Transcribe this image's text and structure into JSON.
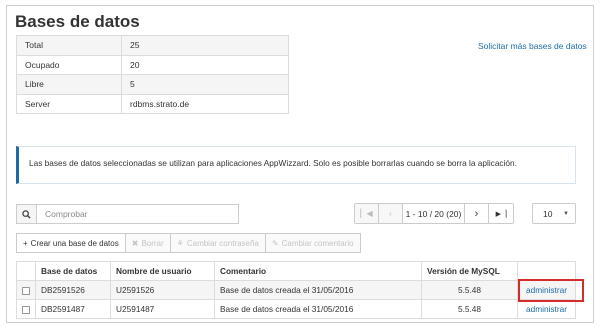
{
  "page_title": "Bases de datos",
  "stats": [
    {
      "label": "Total",
      "value": "25"
    },
    {
      "label": "Ocupado",
      "value": "20"
    },
    {
      "label": "Libre",
      "value": "5"
    },
    {
      "label": "Server",
      "value": "rdbms.strato.de"
    }
  ],
  "request_link": "Solicitar más bases de datos",
  "info_text": "Las bases de datos seleccionadas se utilizan para aplicaciones AppWizzard. Solo es posible borrarlas cuando se borra la aplicación.",
  "search": {
    "placeholder": "Comprobar"
  },
  "pagination": {
    "info": "1 - 10 / 20 (20)",
    "per_page": "10"
  },
  "toolbar": {
    "create": "Crear una base de datos",
    "delete": "Borrar",
    "change_password": "Cambiar contraseña",
    "change_comment": "Cambiar comentario"
  },
  "table": {
    "headers": [
      "Base de datos",
      "Nombre de usuario",
      "Comentario",
      "Versión de MySQL"
    ],
    "rows": [
      {
        "db": "DB2591526",
        "user": "U2591526",
        "comment": "Base de datos creada el 31/05/2016",
        "version": "5.5.48",
        "action": "administrar"
      },
      {
        "db": "DB2591487",
        "user": "U2591487",
        "comment": "Base de datos creada el 31/05/2016",
        "version": "5.5.48",
        "action": "administrar"
      }
    ]
  },
  "colors": {
    "link": "#1f6ba8",
    "highlight": "#d62b2b",
    "info_border": "#1f6ba8"
  }
}
